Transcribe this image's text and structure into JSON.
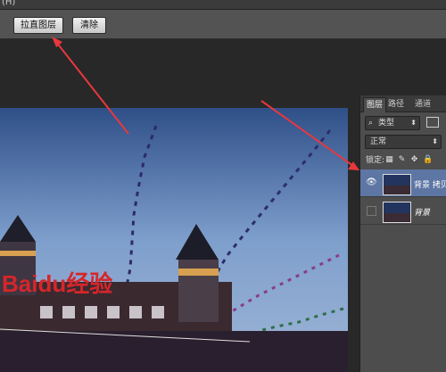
{
  "menubar": {
    "text": "(H)"
  },
  "options_bar": {
    "straighten_label": "拉直图层",
    "clear_label": "清除"
  },
  "layers_panel": {
    "tabs": [
      {
        "label": "图层"
      },
      {
        "label": "路径"
      },
      {
        "label": "通道"
      }
    ],
    "filter_kind": "类型",
    "blend_mode": "正常",
    "lock_label": "锁定:",
    "layers": [
      {
        "name": "背景 拷贝",
        "visible": true,
        "selected": true
      },
      {
        "name": "背景",
        "visible": false,
        "selected": false
      }
    ]
  },
  "canvas": {
    "watermark": "Baidu经验"
  },
  "colors": {
    "panel_bg": "#4d4d4d",
    "selected_layer": "#5d76a4",
    "arrow": "#e8383d"
  }
}
